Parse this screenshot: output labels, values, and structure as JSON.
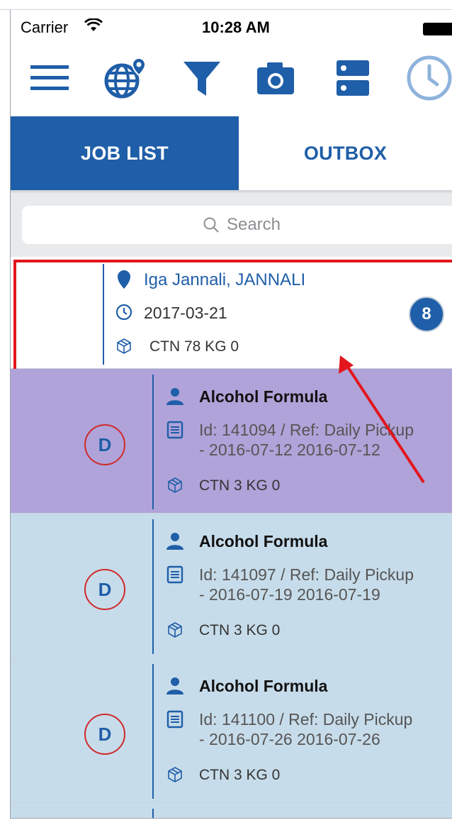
{
  "status_bar": {
    "carrier": "Carrier",
    "time": "10:28 AM"
  },
  "toolbar": {
    "icons": [
      "menu-icon",
      "globe-pin-icon",
      "filter-icon",
      "camera-icon",
      "server-icon",
      "clock-icon"
    ]
  },
  "tabs": [
    {
      "label": "JOB LIST",
      "active": true
    },
    {
      "label": "OUTBOX",
      "active": false
    }
  ],
  "search": {
    "placeholder": "Search"
  },
  "location_row": {
    "name": "Iga Jannali, JANNALI",
    "date": "2017-03-21",
    "cargo": "CTN 78 KG 0",
    "count": "8"
  },
  "jobs": [
    {
      "status_letter": "D",
      "name": "Alcohol Formula",
      "ref": "Id: 141094 / Ref: Daily Pickup\n- 2016-07-12 2016-07-12",
      "cargo": "CTN 3 KG 0",
      "color": "#b0a3d9"
    },
    {
      "status_letter": "D",
      "name": "Alcohol Formula",
      "ref": "Id: 141097 / Ref: Daily Pickup\n- 2016-07-19 2016-07-19",
      "cargo": "CTN 3 KG 0",
      "color": "#c7dcea"
    },
    {
      "status_letter": "D",
      "name": "Alcohol Formula",
      "ref": "Id: 141100 / Ref: Daily Pickup\n- 2016-07-26 2016-07-26",
      "cargo": "CTN 3 KG 0",
      "color": "#c7dcea"
    }
  ],
  "colors": {
    "brand": "#1f5ea8",
    "highlight": "#e3161d",
    "arrow": "#e3161d"
  }
}
